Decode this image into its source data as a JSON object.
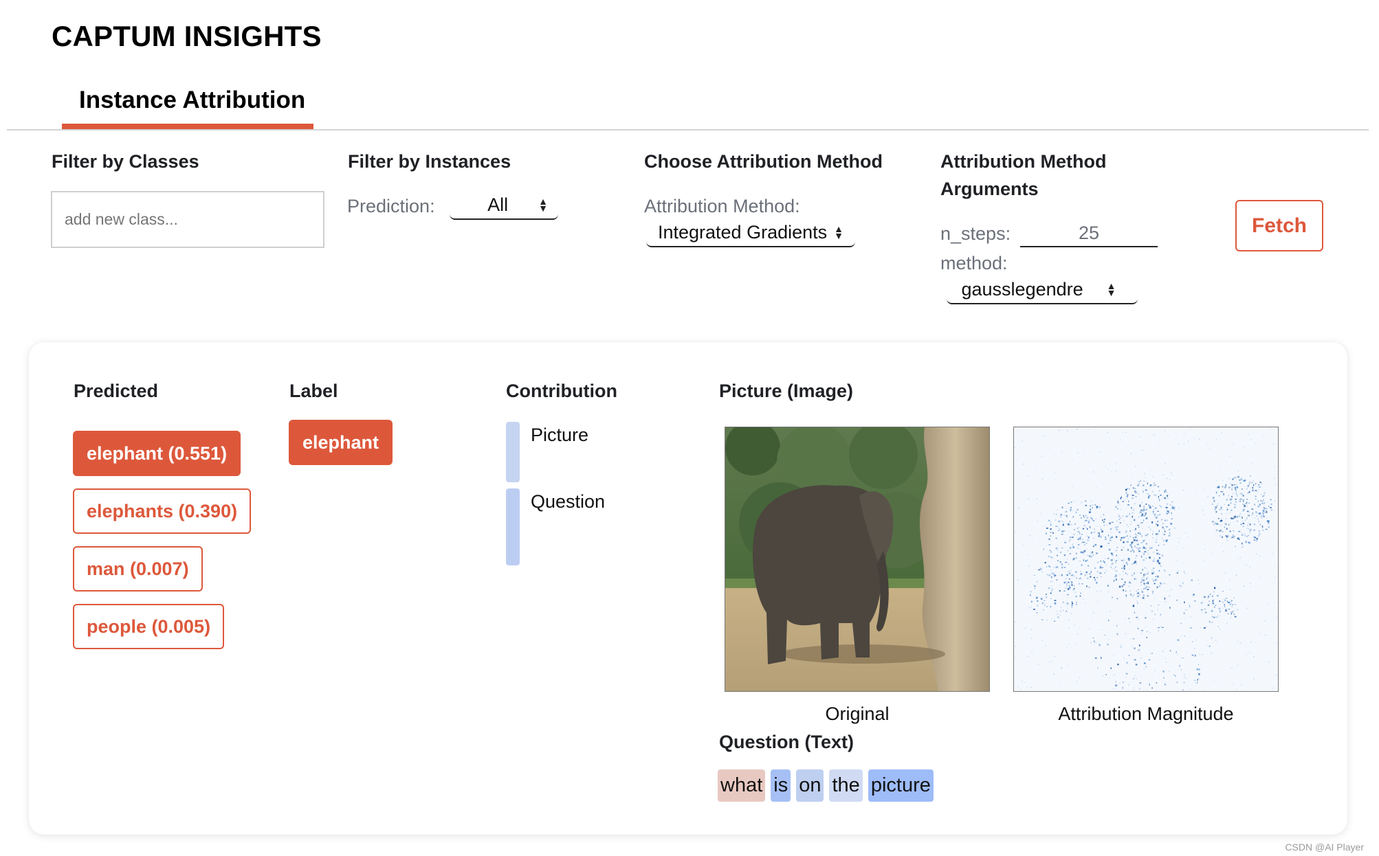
{
  "app": {
    "title": "CAPTUM INSIGHTS",
    "accent_color": "#dd583b"
  },
  "tabs": [
    {
      "label": "Instance Attribution",
      "active": true
    }
  ],
  "filters": {
    "classes": {
      "heading": "Filter by Classes",
      "input_placeholder": "add new class...",
      "input_value": ""
    },
    "instances": {
      "heading": "Filter by Instances",
      "prediction_label": "Prediction:",
      "prediction_value": "All"
    },
    "method": {
      "heading": "Choose Attribution Method",
      "method_label": "Attribution Method:",
      "method_value": "Integrated Gradients"
    },
    "arguments": {
      "heading_line1": "Attribution Method",
      "heading_line2": "Arguments",
      "n_steps_label": "n_steps:",
      "n_steps_value": "25",
      "method_label": "method:",
      "method_value": "gausslegendre"
    },
    "fetch_label": "Fetch"
  },
  "result": {
    "headers": {
      "predicted": "Predicted",
      "label": "Label",
      "contribution": "Contribution",
      "picture": "Picture (Image)",
      "question": "Question (Text)"
    },
    "predictions": [
      {
        "text": "elephant (0.551)",
        "class": "elephant",
        "score": 0.551,
        "selected": true
      },
      {
        "text": "elephants (0.390)",
        "class": "elephants",
        "score": 0.39,
        "selected": false
      },
      {
        "text": "man (0.007)",
        "class": "man",
        "score": 0.007,
        "selected": false
      },
      {
        "text": "people (0.005)",
        "class": "people",
        "score": 0.005,
        "selected": false
      }
    ],
    "label": "elephant",
    "contributions": [
      {
        "name": "Picture",
        "value": 0.44,
        "color": "#c5d4f0"
      },
      {
        "name": "Question",
        "value": 0.56,
        "color": "#bccdf2"
      }
    ],
    "images": {
      "original_caption": "Original",
      "attribution_caption": "Attribution Magnitude",
      "original_icon": "elephant-photo",
      "attribution_icon": "attribution-heatmap"
    },
    "question_tokens": [
      {
        "text": "what",
        "color": "#e8c9c1"
      },
      {
        "text": "is",
        "color": "#a6c0f5"
      },
      {
        "text": "on",
        "color": "#bfcff0"
      },
      {
        "text": "the",
        "color": "#d0dbf3"
      },
      {
        "text": "picture",
        "color": "#9ebcf7"
      }
    ]
  },
  "watermark": "CSDN @AI Player"
}
